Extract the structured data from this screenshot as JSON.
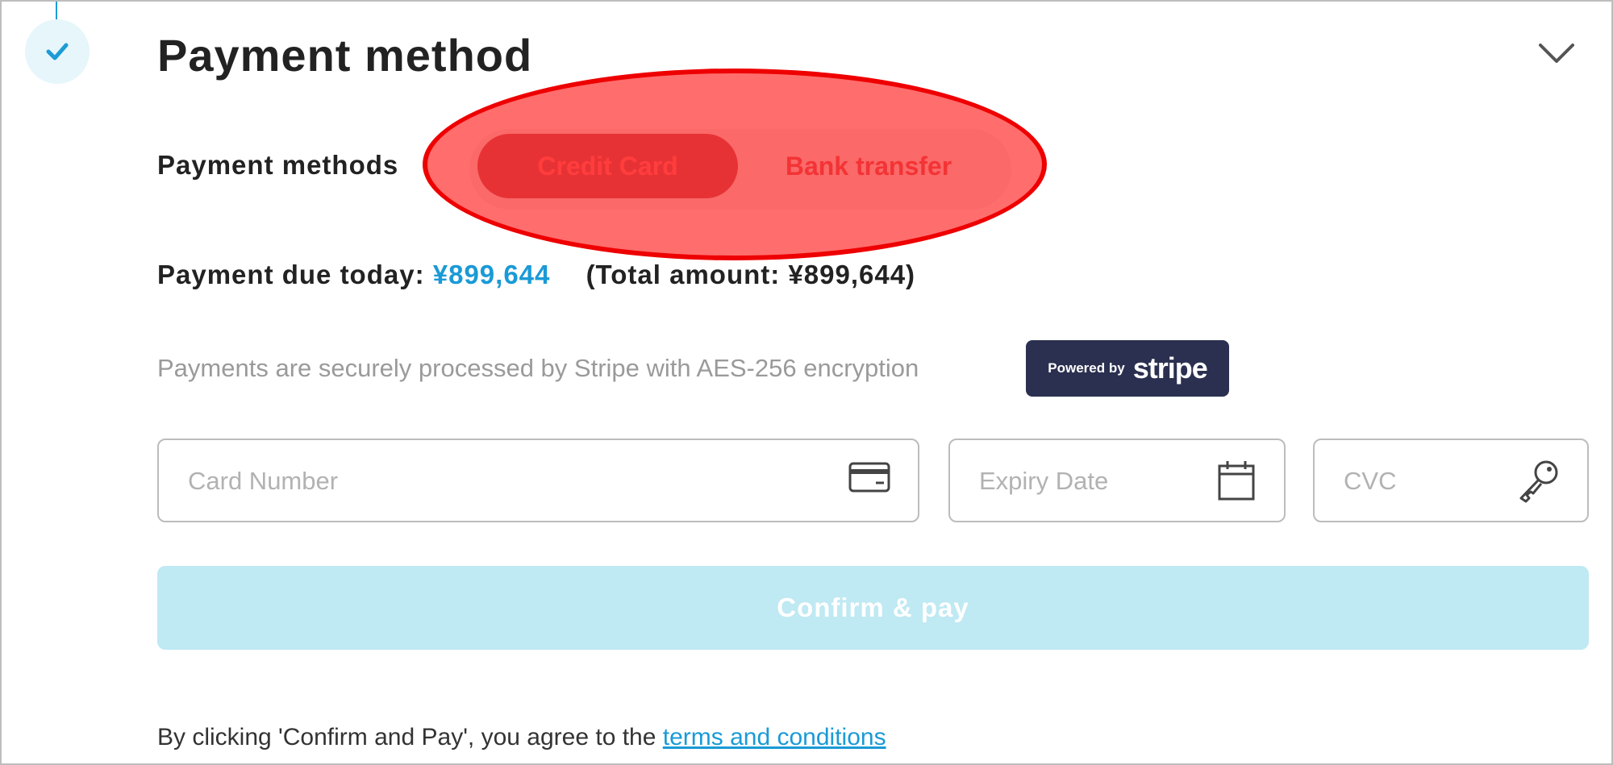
{
  "section": {
    "title": "Payment method",
    "step_icon": "check-icon",
    "collapse_icon": "chevron-down-icon"
  },
  "methods": {
    "label": "Payment methods",
    "options": [
      "Credit Card",
      "Bank transfer"
    ],
    "selected": "Credit Card"
  },
  "payment": {
    "due_label": "Payment due today:",
    "due_amount": "¥899,644",
    "total_text": "(Total amount: ¥899,644)"
  },
  "security": {
    "text": "Payments are securely processed by Stripe with AES-256 encryption",
    "badge_prefix": "Powered by",
    "badge_brand": "stripe"
  },
  "fields": {
    "card_number": {
      "placeholder": "Card Number",
      "value": "",
      "icon": "credit-card-icon"
    },
    "expiry": {
      "placeholder": "Expiry Date",
      "value": "",
      "icon": "calendar-icon"
    },
    "cvc": {
      "placeholder": "CVC",
      "value": "",
      "icon": "key-icon"
    }
  },
  "confirm_button": {
    "label": "Confirm & pay"
  },
  "agreement": {
    "text": "By clicking 'Confirm and Pay', you agree to the ",
    "link": "terms and conditions"
  },
  "colors": {
    "accent": "#1a9ad6",
    "confirm_bg": "#bfe9f3",
    "stripe_badge": "#2b3050",
    "annotation": "#ee0000"
  }
}
